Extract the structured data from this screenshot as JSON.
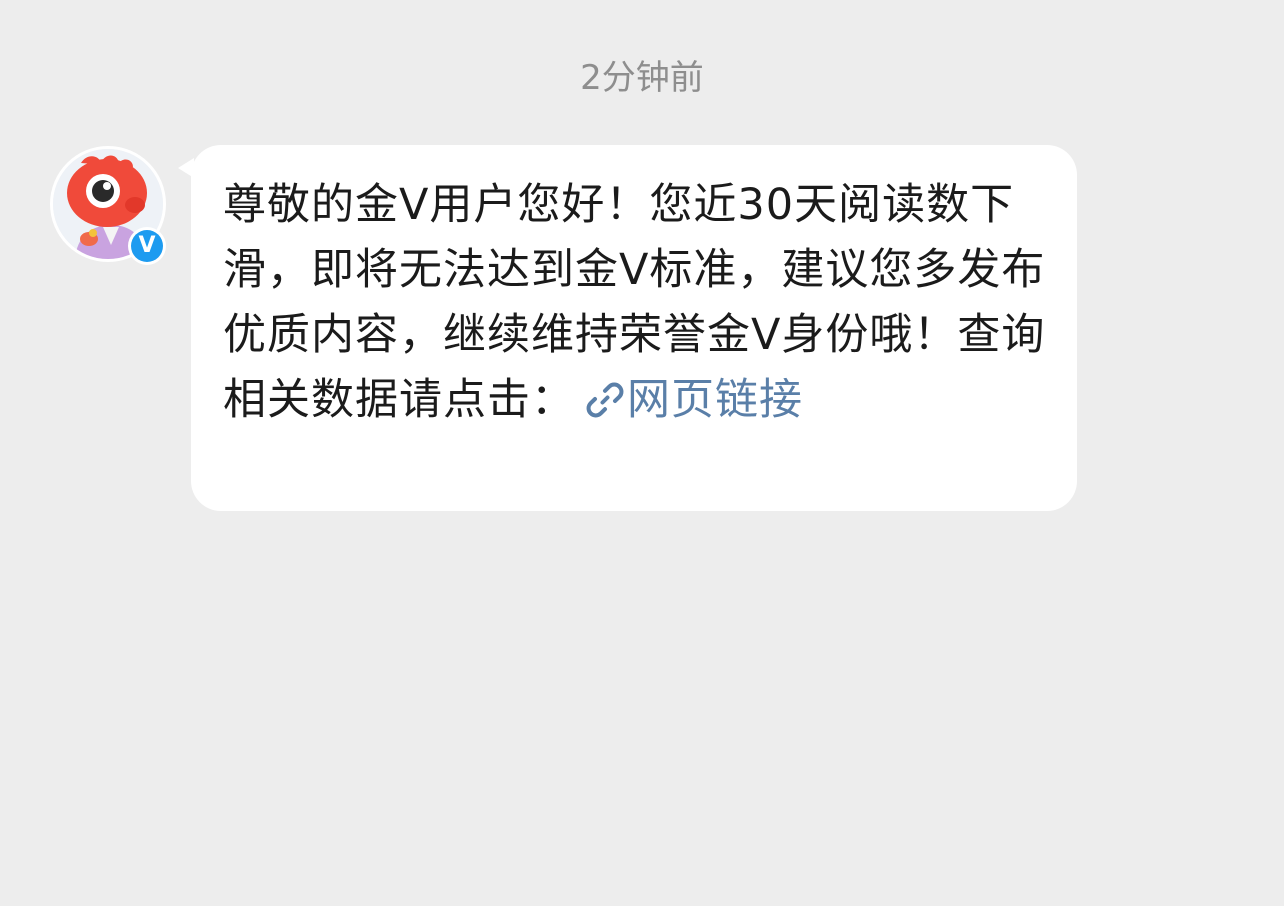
{
  "chat": {
    "timestamp": "2分钟前",
    "sender": {
      "avatar_icon": "red-mascot-avatar",
      "verified_badge": "V",
      "verified_color": "#1d9bf0"
    },
    "message": {
      "text": "尊敬的金V用户您好！您近30天阅读数下滑，即将无法达到金V标准，建议您多发布优质内容，继续维持荣誉金V身份哦！查询相关数据请点击：",
      "link_icon": "link-icon",
      "link_label": "网页链接",
      "link_color": "#5a7fa8"
    }
  }
}
